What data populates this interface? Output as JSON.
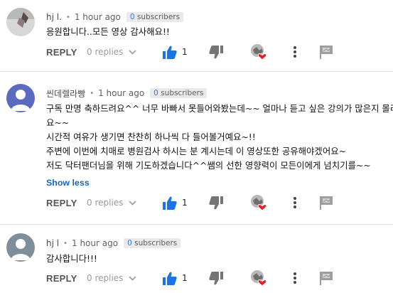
{
  "comments": [
    {
      "author": "hj l.",
      "time": "1 hour ago",
      "subs_num": "0",
      "subs_word": "subscribers",
      "text_lines": [
        "응원합니다..모든 영상 감사해요!!"
      ],
      "show_less": "",
      "reply_label": "REPLY",
      "replies_label": "0 replies",
      "like_count": "1",
      "avatar_color": "#c8c8c8"
    },
    {
      "author": "씬데렐라빵",
      "time": "1 hour ago",
      "subs_num": "0",
      "subs_word": "subscribers",
      "text_lines": [
        "구독 만명 축하드려요^^ 너무 바빠서 못들어와봤는데~~  얼마나 듣고 싶은 강의가 많은지 몰라",
        "요~~",
        "시간적 여유가 생기면 찬찬히 하나씩 다 들어볼거예요~!!",
        "주변에 이번에 치매로 병원검사 하시는 분 계시는데 이 영상또한 공유해야겠어요~",
        "저도 닥터팬더님을 위해 기도하겠습니다^^쌤의 선한 영향력이 모든이에게 넘치기를~~"
      ],
      "show_less": "Show less",
      "reply_label": "REPLY",
      "replies_label": "0 replies",
      "like_count": "1",
      "avatar_color": "#5c6bc0"
    },
    {
      "author": "hj l",
      "time": "1 hour ago",
      "subs_num": "0",
      "subs_word": "subscribers",
      "text_lines": [
        "감사합니다!!!"
      ],
      "show_less": "",
      "reply_label": "REPLY",
      "replies_label": "0 replies",
      "like_count": "1",
      "avatar_color": "#7f8f99"
    }
  ],
  "colors": {
    "like_blue": "#1a73e8",
    "heart_red": "#e5202e",
    "link_blue": "#1565c0"
  },
  "icons": {
    "like": "thumbs-up-icon",
    "dislike": "thumbs-down-icon",
    "creator_heart": "creator-heart-icon",
    "more": "more-vertical-icon",
    "flag": "flag-icon",
    "chevron": "chevron-down-icon"
  }
}
